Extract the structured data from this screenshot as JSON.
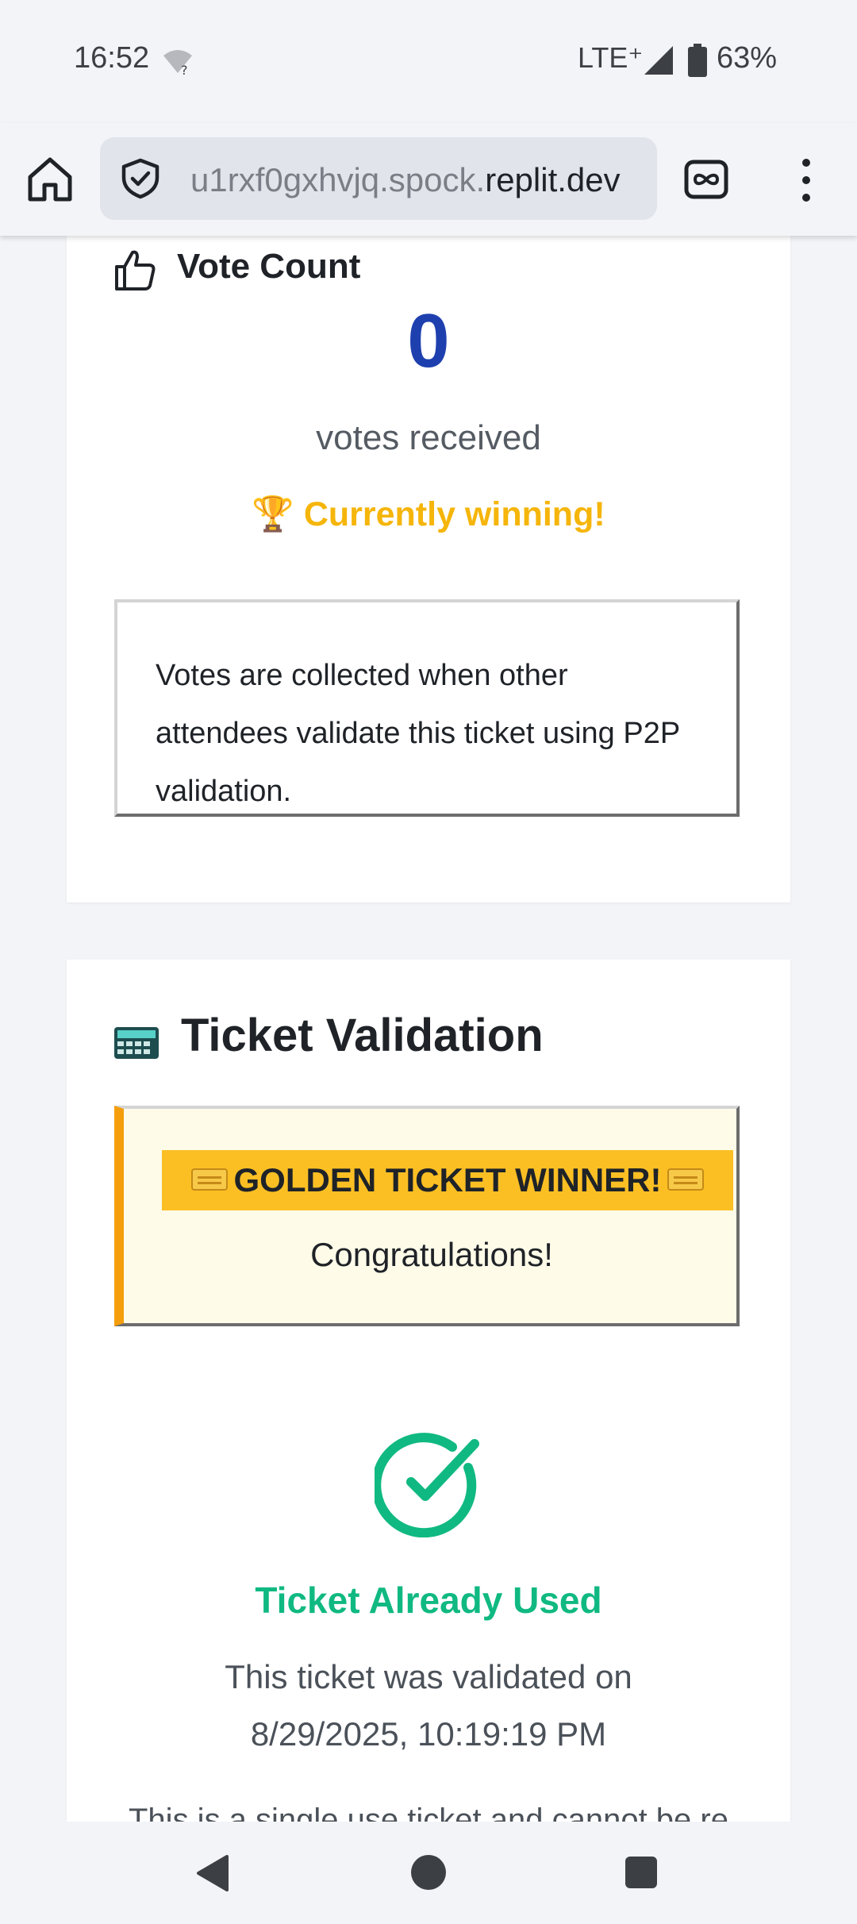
{
  "status_bar": {
    "time": "16:52",
    "network": "LTE⁺",
    "battery": "63%",
    "icons": [
      "wifi-unknown-icon",
      "signal-icon",
      "battery-icon"
    ]
  },
  "browser": {
    "url_prefix": "u1rxf0gxhvjq.spock.",
    "url_domain": "replit.dev",
    "icons": [
      "home-icon",
      "shield-check-icon",
      "tabs-infinity-icon",
      "more-vert-icon"
    ]
  },
  "vote_card": {
    "title": "Vote Count",
    "count": "0",
    "count_label": "votes received",
    "winning_text": "🏆 Currently winning!",
    "info_text": "Votes are collected when other attendees validate this ticket using P2P validation."
  },
  "validation_card": {
    "title": "Ticket Validation",
    "golden_banner": "GOLDEN TICKET WINNER!",
    "congrats": "Congratulations!",
    "status_title": "Ticket Already Used",
    "validated_text": "This ticket was validated on 8/29/2025, 10:19:19 PM",
    "single_use_text": "This is a single use ticket and cannot be re"
  },
  "colors": {
    "vote_number": "#1e40af",
    "winning": "#f5b50a",
    "golden_banner": "#fbbf24",
    "golden_border": "#f59e0b",
    "success": "#10b981"
  }
}
